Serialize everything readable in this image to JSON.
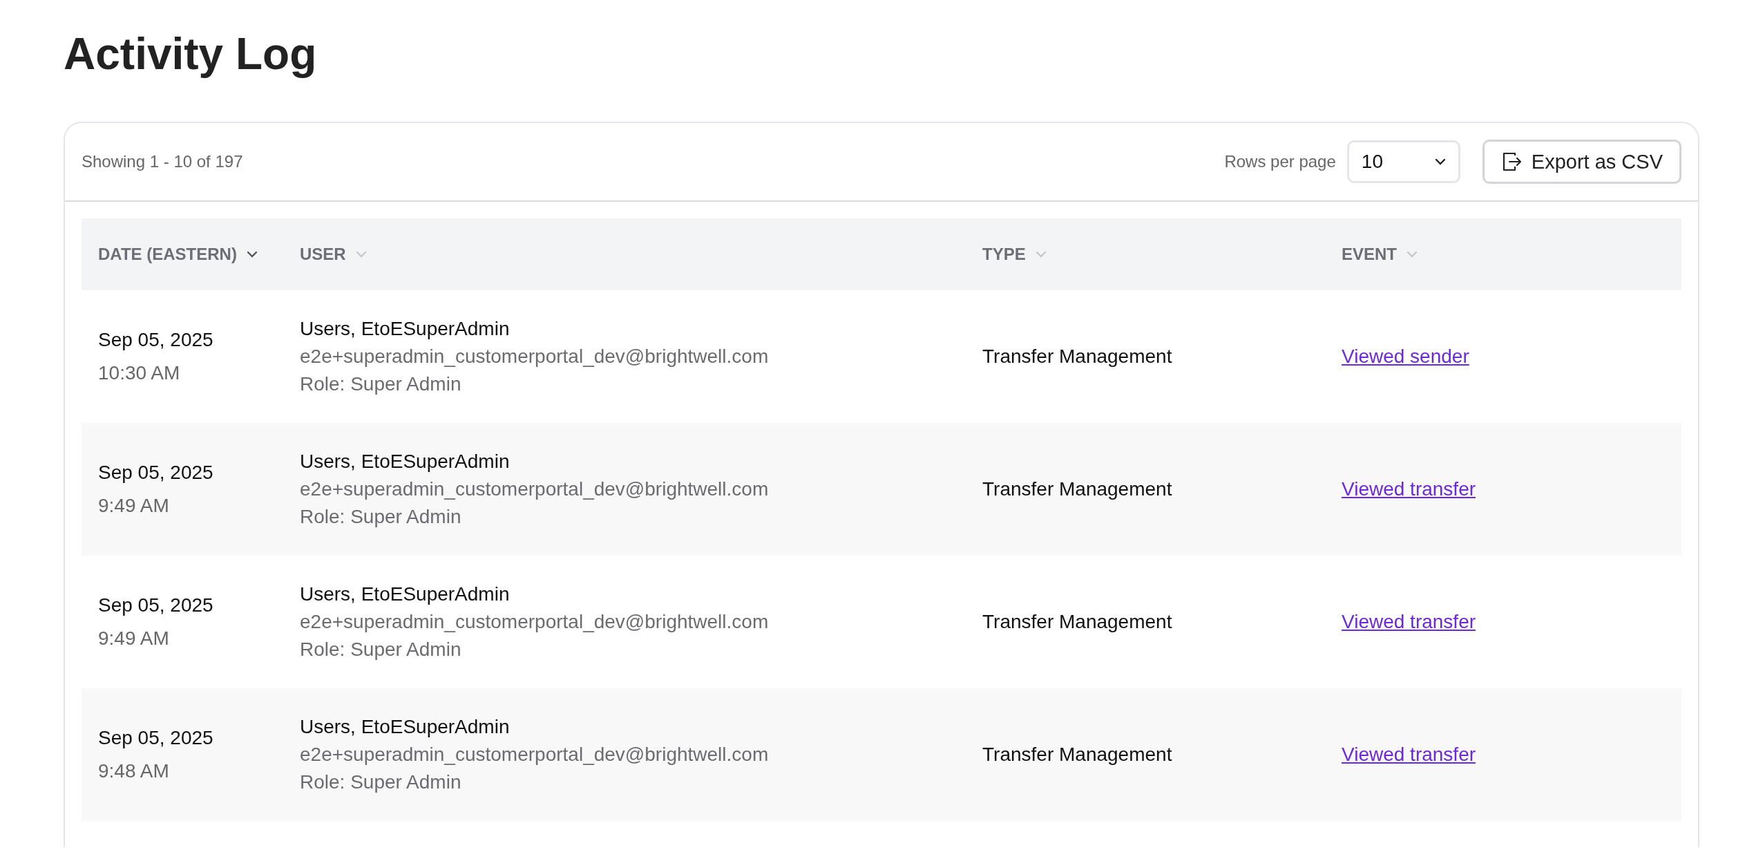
{
  "page": {
    "title": "Activity Log"
  },
  "toolbar": {
    "summary": "Showing 1 - 10 of 197",
    "rows_per_page_label": "Rows per page",
    "rows_per_page_value": "10",
    "export_button": "Export as CSV"
  },
  "table": {
    "columns": [
      {
        "label": "DATE (EASTERN)",
        "sorted": true
      },
      {
        "label": "USER",
        "sorted": false
      },
      {
        "label": "TYPE",
        "sorted": false
      },
      {
        "label": "EVENT",
        "sorted": false
      }
    ],
    "rows": [
      {
        "date": "Sep 05, 2025",
        "time": "10:30 AM",
        "user_name": "Users, EtoESuperAdmin",
        "user_email": "e2e+superadmin_customerportal_dev@brightwell.com",
        "user_role": "Role: Super Admin",
        "type": "Transfer Management",
        "event": "Viewed sender"
      },
      {
        "date": "Sep 05, 2025",
        "time": "9:49 AM",
        "user_name": "Users, EtoESuperAdmin",
        "user_email": "e2e+superadmin_customerportal_dev@brightwell.com",
        "user_role": "Role: Super Admin",
        "type": "Transfer Management",
        "event": "Viewed transfer"
      },
      {
        "date": "Sep 05, 2025",
        "time": "9:49 AM",
        "user_name": "Users, EtoESuperAdmin",
        "user_email": "e2e+superadmin_customerportal_dev@brightwell.com",
        "user_role": "Role: Super Admin",
        "type": "Transfer Management",
        "event": "Viewed transfer"
      },
      {
        "date": "Sep 05, 2025",
        "time": "9:48 AM",
        "user_name": "Users, EtoESuperAdmin",
        "user_email": "e2e+superadmin_customerportal_dev@brightwell.com",
        "user_role": "Role: Super Admin",
        "type": "Transfer Management",
        "event": "Viewed transfer"
      }
    ]
  }
}
